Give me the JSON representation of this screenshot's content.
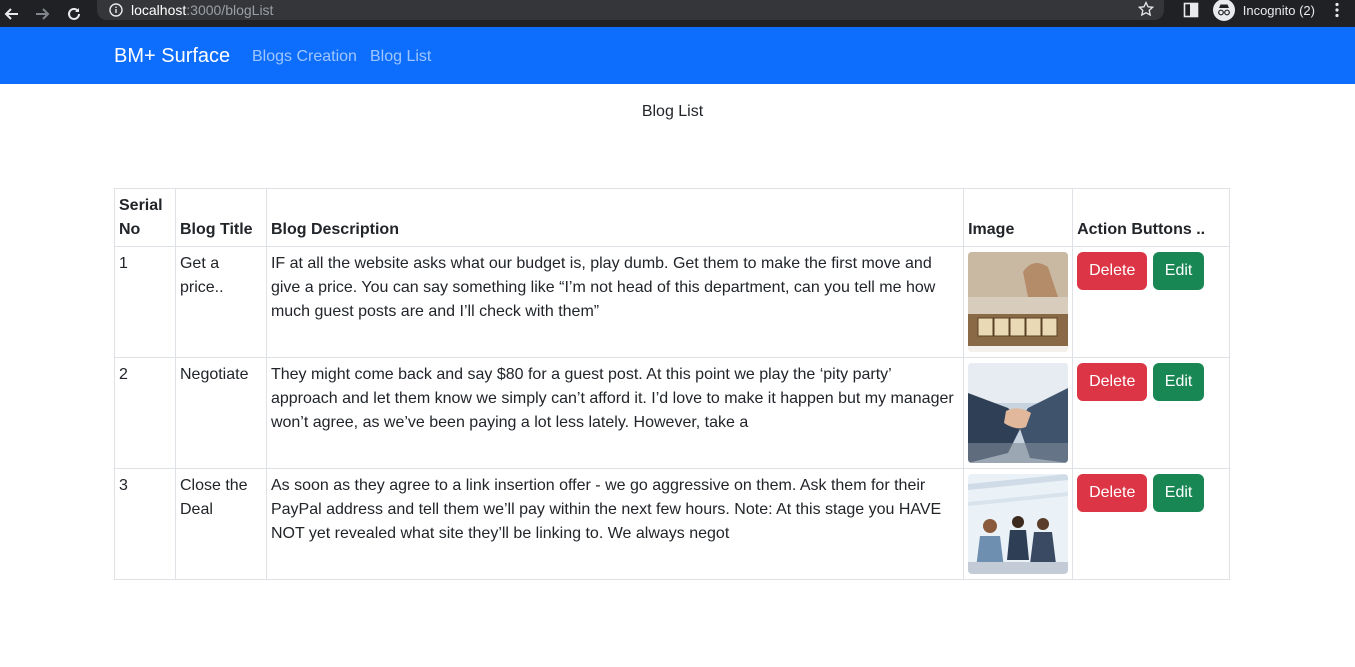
{
  "browser": {
    "url_host": "localhost",
    "url_path": ":3000/blogList",
    "profile_label": "Incognito (2)"
  },
  "navbar": {
    "brand": "BM+ Surface",
    "links": [
      "Blogs Creation",
      "Blog List"
    ]
  },
  "page": {
    "title": "Blog List"
  },
  "table": {
    "headers": {
      "serial_line1": "Serial",
      "serial_line2": "No",
      "title": "Blog Title",
      "description": "Blog Description",
      "image": "Image",
      "actions": "Action Buttons .."
    },
    "rows": [
      {
        "serial": "1",
        "title": "Get a price..",
        "description": "IF at all the website asks what our budget is, play dumb. Get them to make the first move and give a price. You can say something like “I’m not head of this department, can you tell me how much guest posts are and I’ll check with them”",
        "image": "price-blocks-photo",
        "delete_label": "Delete",
        "edit_label": "Edit"
      },
      {
        "serial": "2",
        "title": "Negotiate",
        "description": "They might come back and say $80 for a guest post. At this point we play the ‘pity party’ approach and let them know we simply can’t afford it. I’d love to make it happen but my manager won’t agree, as we’ve been paying a lot less lately. However, take a",
        "image": "handshake-photo",
        "delete_label": "Delete",
        "edit_label": "Edit"
      },
      {
        "serial": "3",
        "title": "Close the Deal",
        "description": "As soon as they agree to a link insertion offer - we go aggressive on them. Ask them for their PayPal address and tell them we’ll pay within the next few hours. Note: At this stage you HAVE NOT yet revealed what site they’ll be linking to. We always negot",
        "image": "business-meeting-photo",
        "delete_label": "Delete",
        "edit_label": "Edit"
      }
    ]
  },
  "colors": {
    "navbar": "#0d6efd",
    "danger": "#dc3545",
    "success": "#198754"
  }
}
